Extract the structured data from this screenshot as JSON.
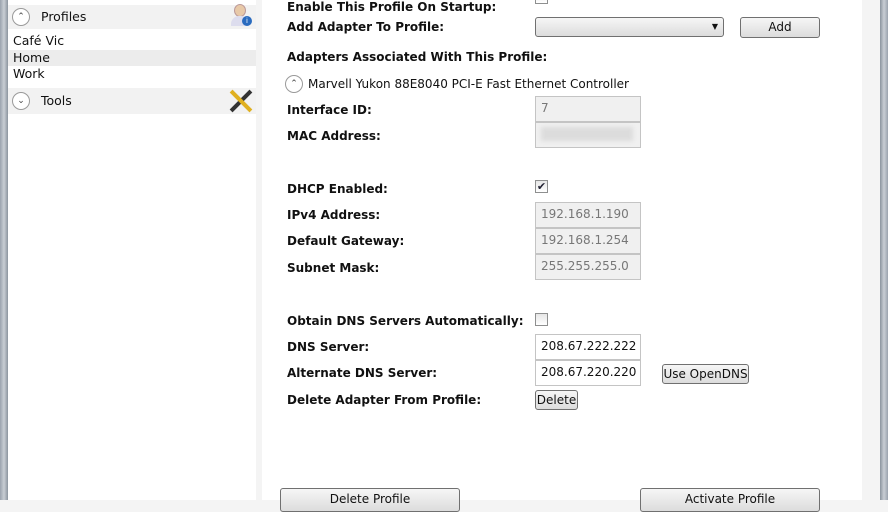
{
  "sidebar": {
    "profiles_header": "Profiles",
    "profiles": [
      "Café Vic",
      "Home",
      "Work"
    ],
    "tools_header": "Tools"
  },
  "form": {
    "enable_startup_label": "Enable This Profile On Startup:",
    "add_adapter_label": "Add Adapter To Profile:",
    "add_button": "Add",
    "adapters_label": "Adapters Associated With This Profile:",
    "adapter_name": "Marvell Yukon 88E8040 PCI-E Fast Ethernet Controller",
    "interface_id_label": "Interface ID:",
    "interface_id": "7",
    "mac_label": "MAC Address:",
    "dhcp_label": "DHCP Enabled:",
    "ipv4_label": "IPv4 Address:",
    "ipv4": "192.168.1.190",
    "gateway_label": "Default Gateway:",
    "gateway": "192.168.1.254",
    "subnet_label": "Subnet Mask:",
    "subnet": "255.255.255.0",
    "obtain_dns_label": "Obtain DNS Servers Automatically:",
    "dns_label": "DNS Server:",
    "dns": "208.67.222.222",
    "alt_dns_label": "Alternate DNS Server:",
    "alt_dns": "208.67.220.220",
    "opendns_button": "Use OpenDNS",
    "delete_adapter_label": "Delete Adapter From Profile:",
    "delete_button": "Delete",
    "delete_profile_button": "Delete Profile",
    "activate_profile_button": "Activate Profile"
  }
}
